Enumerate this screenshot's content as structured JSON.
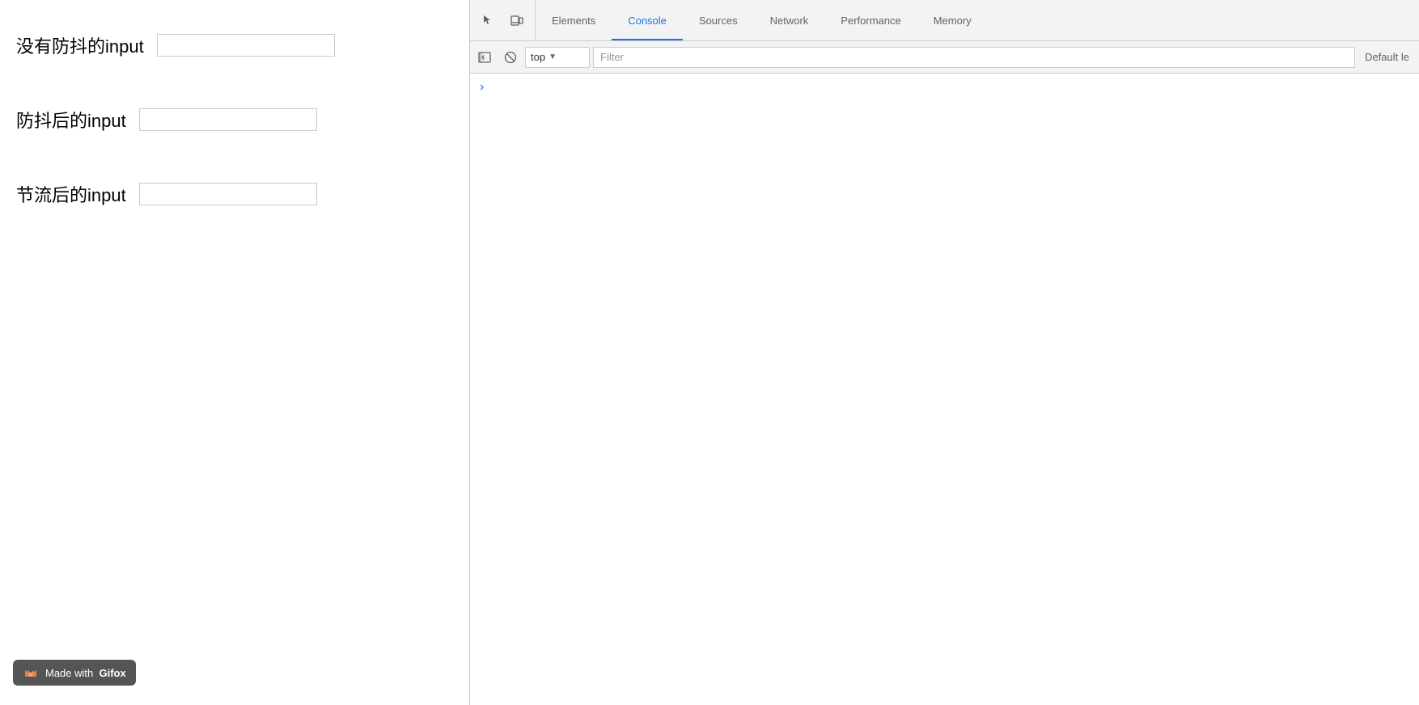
{
  "webpage": {
    "inputs": [
      {
        "label": "没有防抖的input",
        "id": "no-debounce-input",
        "placeholder": ""
      },
      {
        "label": "防抖后的input",
        "id": "debounce-input",
        "placeholder": ""
      },
      {
        "label": "节流后的input",
        "id": "throttle-input",
        "placeholder": ""
      }
    ],
    "gifox_badge": {
      "prefix": "Made with",
      "bold": "Gifox"
    }
  },
  "devtools": {
    "tabs": [
      {
        "label": "Elements",
        "active": false
      },
      {
        "label": "Console",
        "active": true
      },
      {
        "label": "Sources",
        "active": false
      },
      {
        "label": "Network",
        "active": false
      },
      {
        "label": "Performance",
        "active": false
      },
      {
        "label": "Memory",
        "active": false
      }
    ],
    "console": {
      "context": "top",
      "filter_placeholder": "Filter",
      "default_levels": "Default le"
    }
  }
}
